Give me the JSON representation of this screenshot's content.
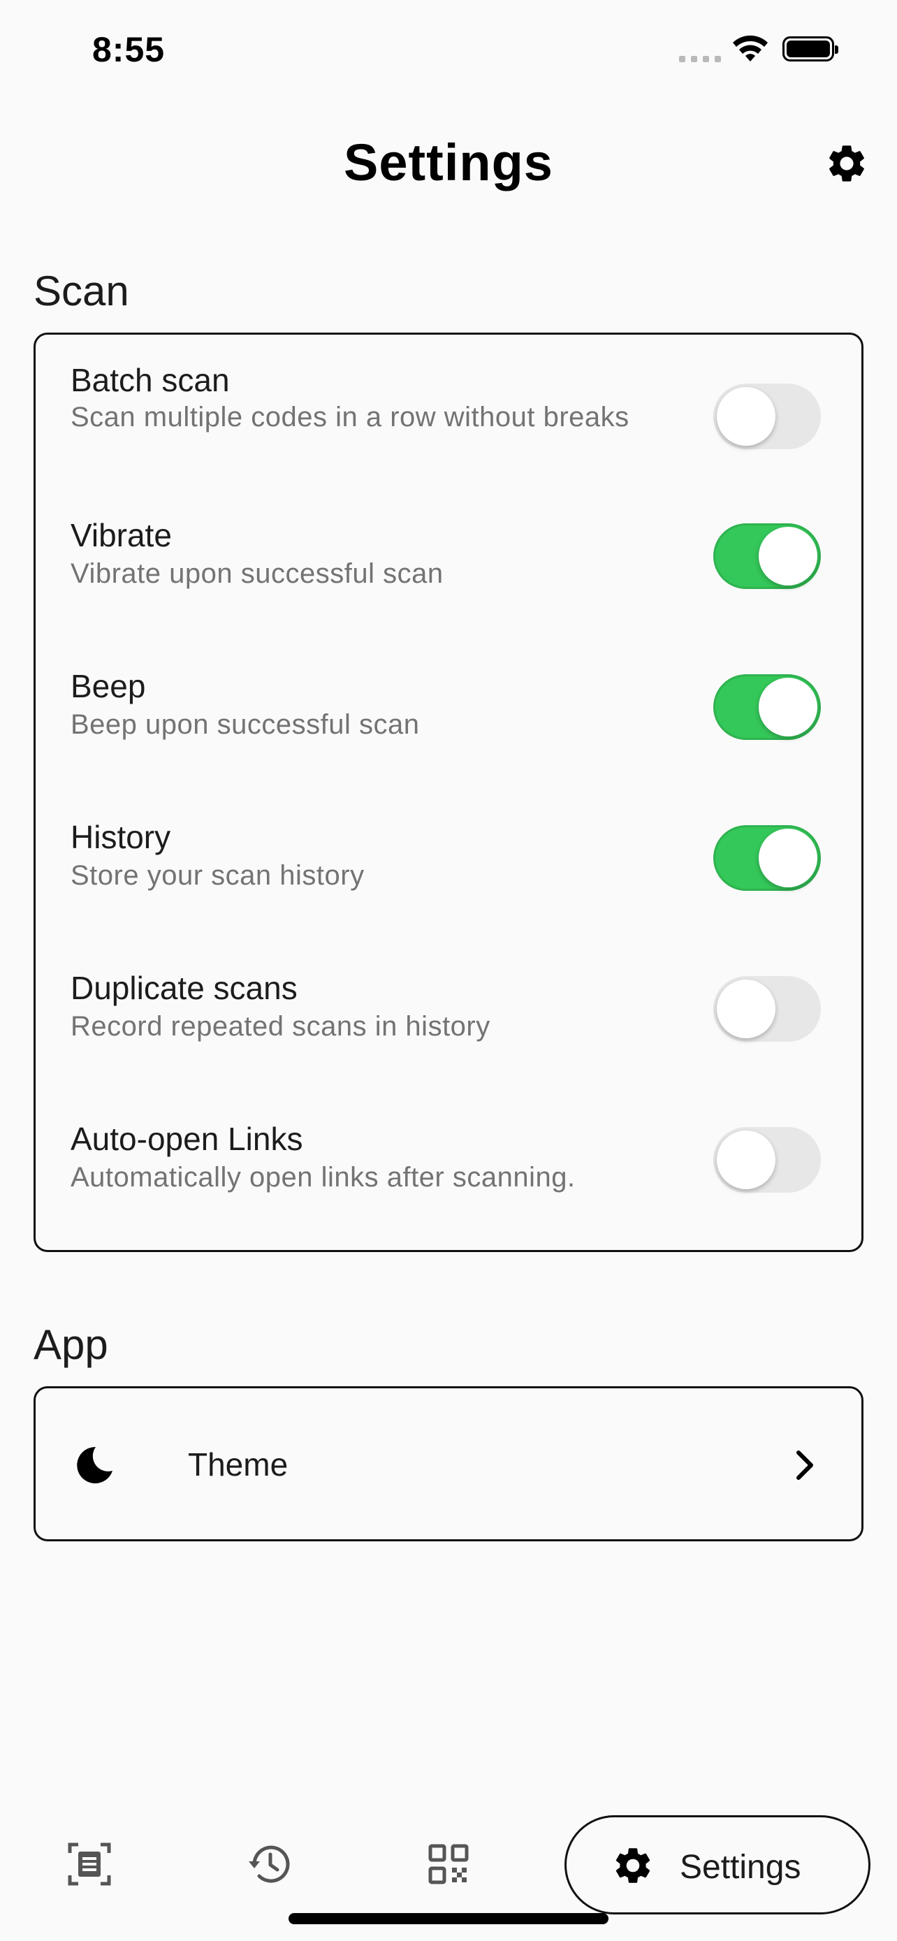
{
  "status_bar": {
    "time": "8:55"
  },
  "header": {
    "title": "Settings",
    "icon": "gear-icon"
  },
  "sections": {
    "scan": {
      "title": "Scan",
      "items": [
        {
          "title": "Batch scan",
          "description": "Scan multiple codes in a row without breaks",
          "enabled": false
        },
        {
          "title": "Vibrate",
          "description": "Vibrate upon successful scan",
          "enabled": true
        },
        {
          "title": "Beep",
          "description": "Beep upon successful scan",
          "enabled": true
        },
        {
          "title": "History",
          "description": "Store your scan history",
          "enabled": true
        },
        {
          "title": "Duplicate scans",
          "description": "Record repeated scans in history",
          "enabled": false
        },
        {
          "title": "Auto-open Links",
          "description": "Automatically open links after scanning.",
          "enabled": false
        }
      ]
    },
    "app": {
      "title": "App",
      "items": [
        {
          "title": "Theme",
          "icon": "moon-icon",
          "trailing_icon": "chevron-right-icon"
        }
      ]
    }
  },
  "bottom_nav": {
    "items": [
      {
        "icon": "scan-icon"
      },
      {
        "icon": "history-icon"
      },
      {
        "icon": "qr-code-icon"
      },
      {
        "icon": "gear-icon",
        "label": "Settings",
        "active": true
      }
    ]
  },
  "colors": {
    "toggle_on": "#34c759",
    "toggle_off": "#e7e7e7",
    "background": "#fafafa"
  }
}
